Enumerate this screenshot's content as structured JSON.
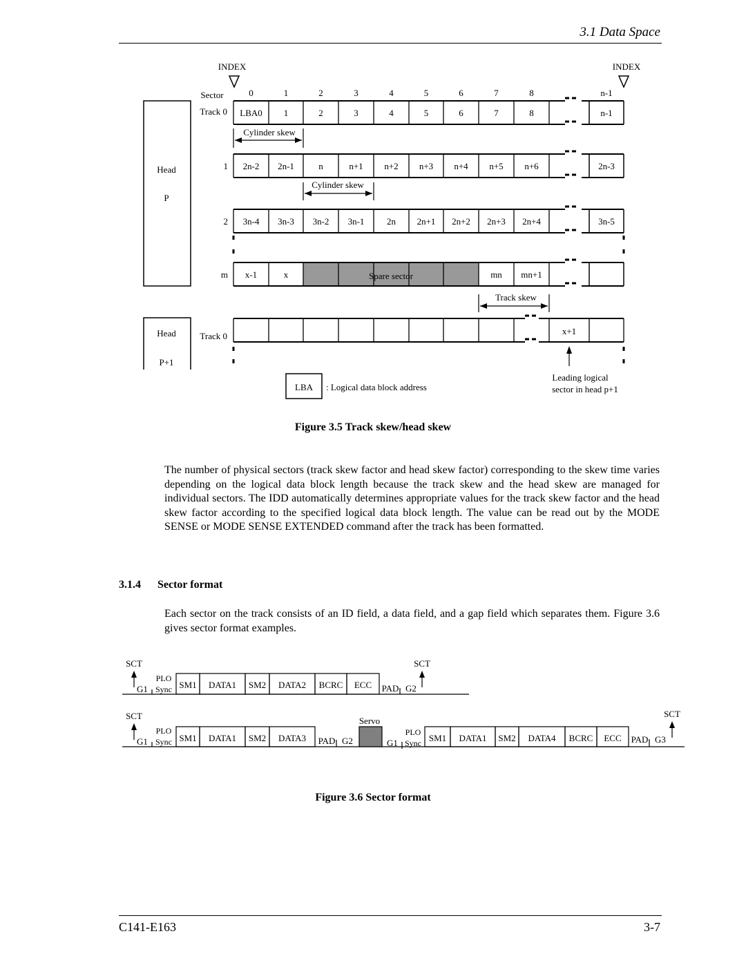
{
  "header": {
    "section": "3.1  Data Space"
  },
  "figure35": {
    "index_label": "INDEX",
    "sector_label": "Sector",
    "sector_numbers": [
      "0",
      "1",
      "2",
      "3",
      "4",
      "5",
      "6",
      "7",
      "8",
      "n-1"
    ],
    "head_p": {
      "head": "Head",
      "p": "P"
    },
    "head_p1": {
      "head": "Head",
      "p": "P+1"
    },
    "rows": [
      {
        "label": "Track 0",
        "cells": [
          "LBA0",
          "1",
          "2",
          "3",
          "4",
          "5",
          "6",
          "7",
          "8"
        ],
        "last": "n-1"
      },
      {
        "label": "1",
        "cells": [
          "2n-2",
          "2n-1",
          "n",
          "n+1",
          "n+2",
          "n+3",
          "n+4",
          "n+5",
          "n+6"
        ],
        "last": "2n-3"
      },
      {
        "label": "2",
        "cells": [
          "3n-4",
          "3n-3",
          "3n-2",
          "3n-1",
          "2n",
          "2n+1",
          "2n+2",
          "2n+3",
          "2n+4"
        ],
        "last": "3n-5"
      },
      {
        "label": "m",
        "cells": [
          "x-1",
          "x",
          "",
          "",
          "",
          "",
          "",
          "mn",
          "mn+1"
        ],
        "last": ""
      }
    ],
    "spare_sector": "Spare sector",
    "spare_color": "#999999",
    "cylinder_skew": "Cylinder skew",
    "track_skew": "Track skew",
    "lower_track_label": "Track 0",
    "lower_cell": "x+1",
    "legend_box": "LBA",
    "legend_text": ": Logical data block address",
    "leading_1": "Leading logical",
    "leading_2": "sector in head p+1",
    "caption": "Figure 3.5     Track skew/head skew"
  },
  "body_para1": "The number of physical sectors (track skew factor and head skew factor) corresponding to the skew time varies depending on the logical data block length because the track skew and the head skew are managed for individual sectors.  The IDD automatically determines appropriate values for the track skew factor and the head skew factor according to the specified logical data block length.  The value can be read out by the MODE SENSE or MODE SENSE EXTENDED command after the track has been formatted.",
  "section": {
    "number": "3.1.4",
    "title": "Sector format"
  },
  "body_para2": "Each sector on the track consists of an ID field, a data field, and a gap field which separates them. Figure 3.6 gives sector format examples.",
  "figure36": {
    "sct": "SCT",
    "g1": "G1",
    "plo": "PLO",
    "sync": "Sync",
    "pad": "PAD",
    "g2": "G2",
    "g3": "G3",
    "servo": "Servo",
    "servo_color": "#808080",
    "row1": [
      "SM1",
      "DATA1",
      "SM2",
      "DATA2",
      "BCRC",
      "ECC"
    ],
    "row2a": [
      "SM1",
      "DATA1",
      "SM2",
      "DATA3"
    ],
    "row2b": [
      "SM1",
      "DATA1",
      "SM2",
      "DATA4",
      "BCRC",
      "ECC"
    ],
    "caption": "Figure 3.6     Sector format"
  },
  "footer": {
    "doc": "C141-E163",
    "page": "3-7"
  }
}
